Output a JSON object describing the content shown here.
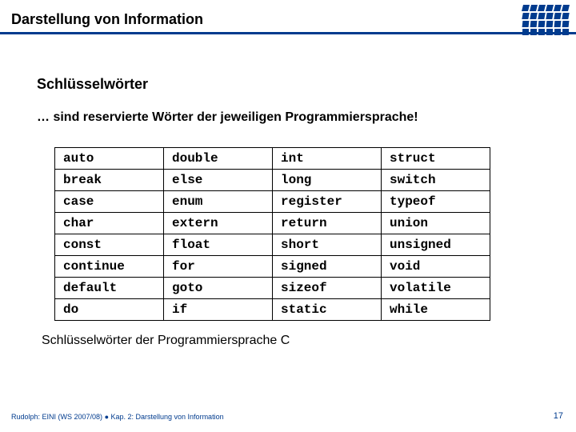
{
  "title": "Darstellung von Information",
  "heading": "Schlüsselwörter",
  "subheading": "… sind reservierte Wörter der jeweiligen Programmiersprache!",
  "chart_data": {
    "type": "table",
    "title": "Schlüsselwörter der Programmiersprache C",
    "columns": 4,
    "rows": [
      [
        "auto",
        "double",
        "int",
        "struct"
      ],
      [
        "break",
        "else",
        "long",
        "switch"
      ],
      [
        "case",
        "enum",
        "register",
        "typeof"
      ],
      [
        "char",
        "extern",
        "return",
        "union"
      ],
      [
        "const",
        "float",
        "short",
        "unsigned"
      ],
      [
        "continue",
        "for",
        "signed",
        "void"
      ],
      [
        "default",
        "goto",
        "sizeof",
        "volatile"
      ],
      [
        "do",
        "if",
        "static",
        "while"
      ]
    ]
  },
  "caption": "Schlüsselwörter der Programmiersprache C",
  "footer": {
    "author": "Rudolph: EINI (WS 2007/08)",
    "sep": " ● ",
    "chapter": "Kap. 2: Darstellung von Information"
  },
  "page_number": "17"
}
